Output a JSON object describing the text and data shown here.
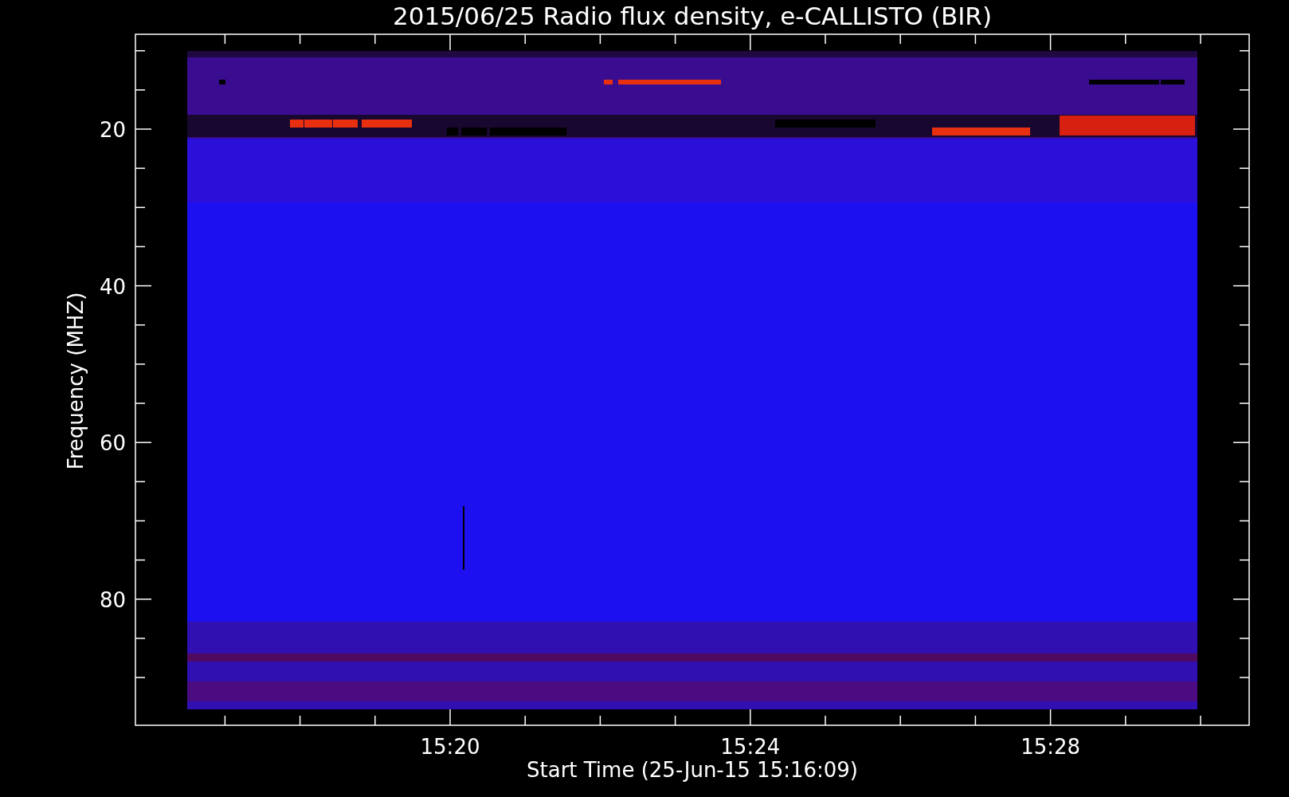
{
  "title": "2015/06/25  Radio flux density, e-CALLISTO (BIR)",
  "y_axis": {
    "label": "Frequency (MHZ)",
    "ticks": [
      "20",
      "40",
      "60",
      "80"
    ]
  },
  "x_axis": {
    "label": "Start Time (25-Jun-15 15:16:09)",
    "ticks": [
      "15:20",
      "15:24",
      "15:28"
    ]
  }
}
